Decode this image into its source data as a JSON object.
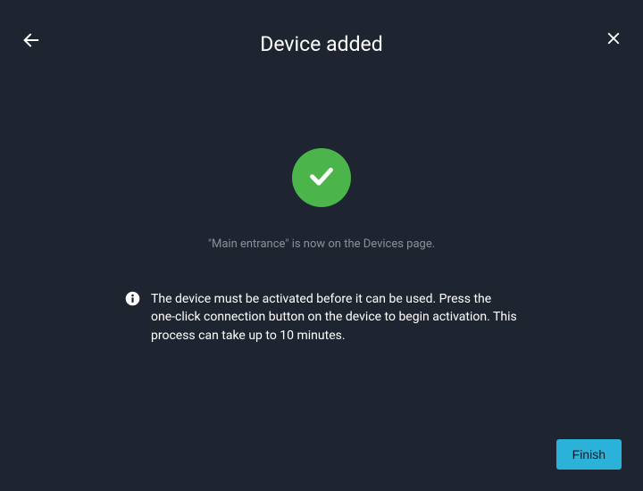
{
  "header": {
    "title": "Device added"
  },
  "content": {
    "status_message": "\"Main entrance\" is now on the Devices page.",
    "info_message": "The device must be activated before it can be used. Press the one-click connection button on the device to begin activation. This process can take up to 10 minutes."
  },
  "actions": {
    "finish_label": "Finish"
  }
}
